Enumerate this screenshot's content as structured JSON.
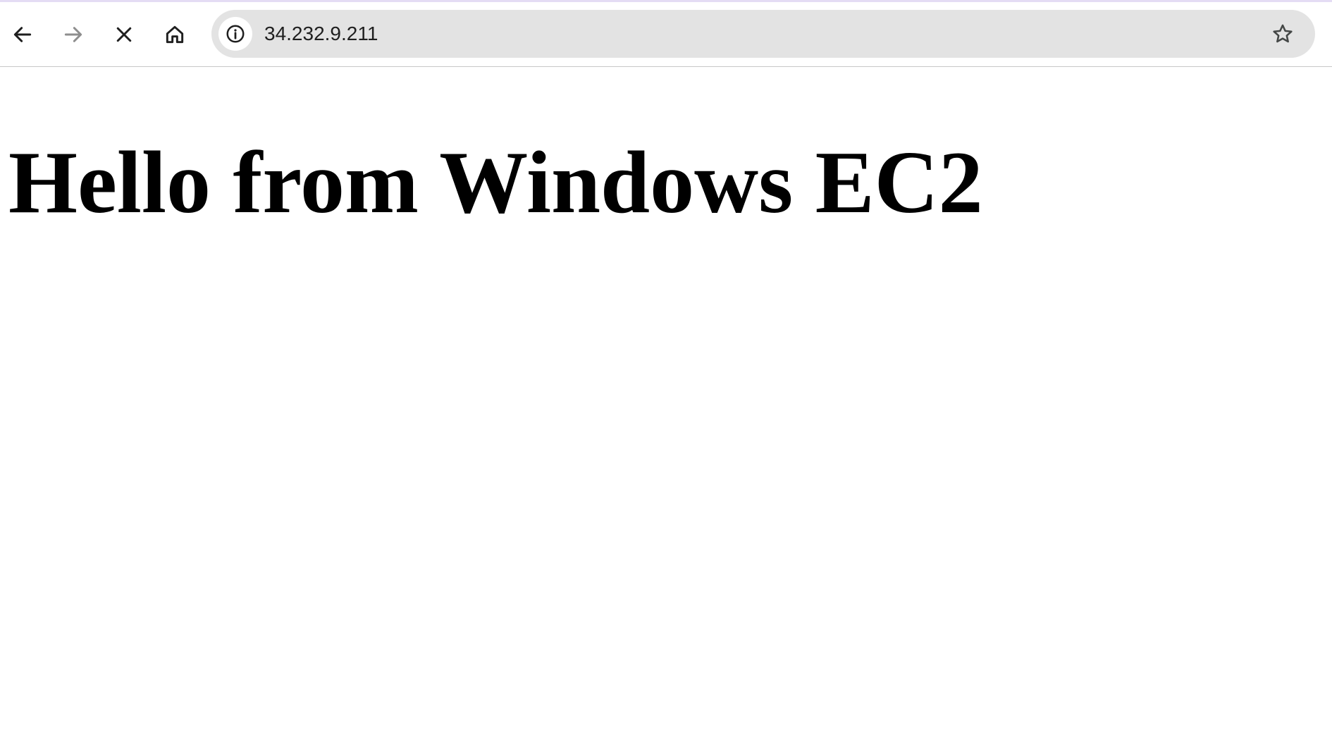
{
  "browser": {
    "toolbar": {
      "back_icon": "arrow-left-icon",
      "forward_icon": "arrow-right-icon",
      "forward_disabled": true,
      "stop_icon": "close-icon",
      "home_icon": "home-icon",
      "star_icon": "star-icon"
    },
    "omnibox": {
      "site_info_icon": "info-icon",
      "url": "34.232.9.211"
    },
    "colors": {
      "accent": "#e4dcf4",
      "omnibox_bg": "#e3e3e3"
    }
  },
  "page": {
    "heading": "Hello from Windows EC2"
  }
}
